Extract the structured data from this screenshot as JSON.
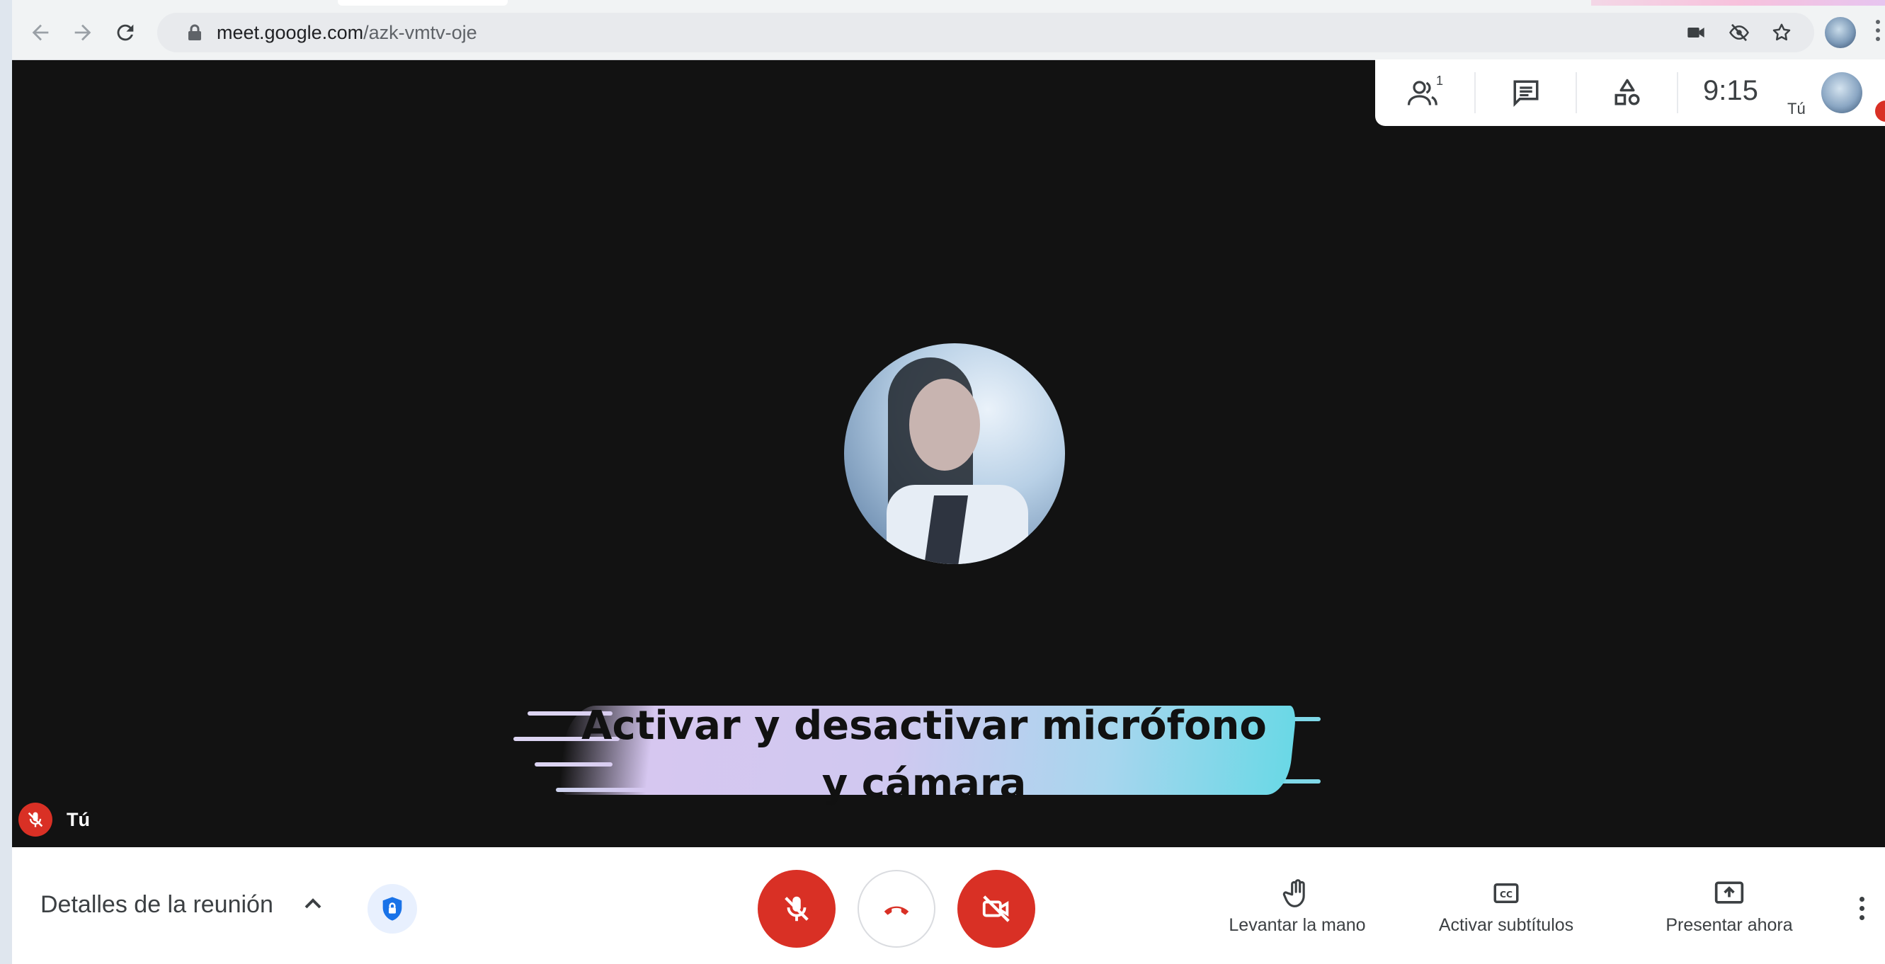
{
  "browser": {
    "url_host": "meet.google.com",
    "url_path": "/azk-vmtv-oje"
  },
  "meeting_topbar": {
    "participants_count": "1",
    "time": "9:15",
    "self_label": "Tú"
  },
  "stage": {
    "self_name": "Tú",
    "banner_line1": "Activar y desactivar micrófono",
    "banner_line2": "y cámara"
  },
  "bottombar": {
    "details_label": "Detalles de la reunión",
    "raise_hand_label": "Levantar la mano",
    "captions_label": "Activar subtítulos",
    "present_label": "Presentar ahora"
  },
  "colors": {
    "danger_red": "#d93025",
    "stage_bg": "#121212",
    "accent_blue": "#1a73e8"
  }
}
